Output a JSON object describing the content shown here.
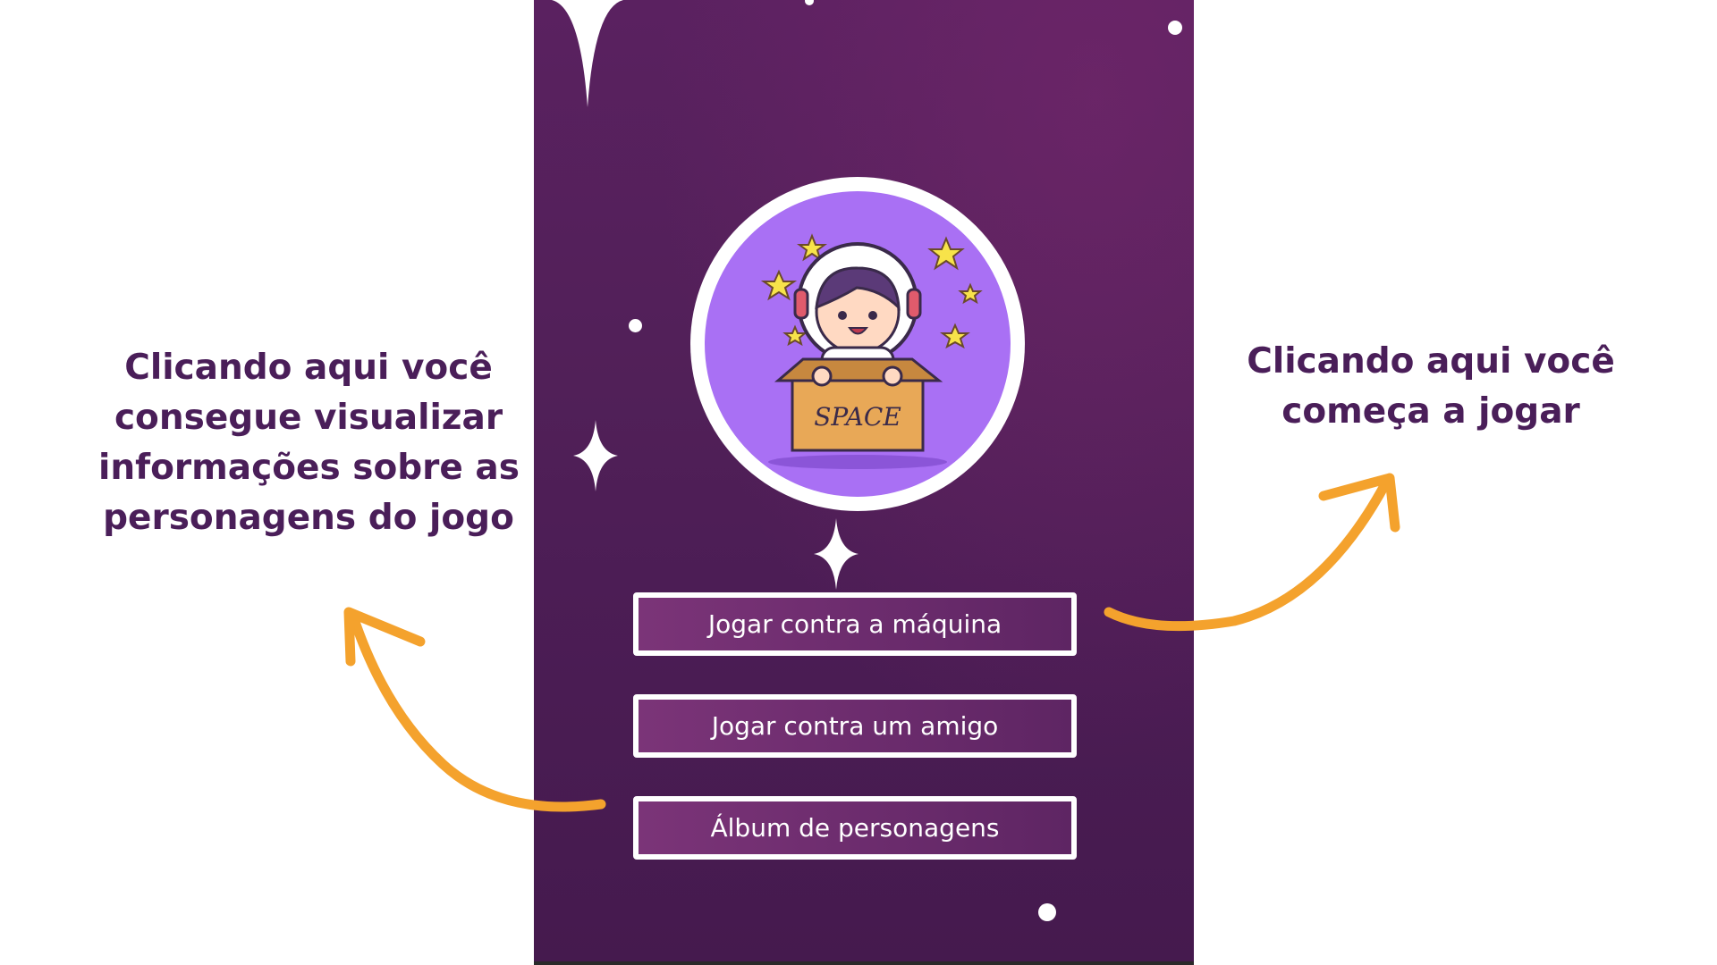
{
  "annotations": {
    "left": {
      "lines": [
        "Clicando aqui você",
        "consegue visualizar",
        "informações sobre as",
        "personagens do jogo"
      ]
    },
    "right": {
      "lines": [
        "Clicando aqui você",
        "começa a jogar"
      ]
    }
  },
  "logo": {
    "box_label": "SPACE",
    "icon": "astronaut-in-box-icon"
  },
  "menu": {
    "buttons": [
      {
        "label": "Jogar contra a máquina"
      },
      {
        "label": "Jogar contra um amigo"
      },
      {
        "label": "Álbum de personagens"
      }
    ]
  },
  "colors": {
    "background_purple": "#51205a",
    "annotation_text": "#4a1e59",
    "arrow": "#f4a22d",
    "logo_purple": "#a970f4",
    "button_fill": "#6a2b6c"
  }
}
